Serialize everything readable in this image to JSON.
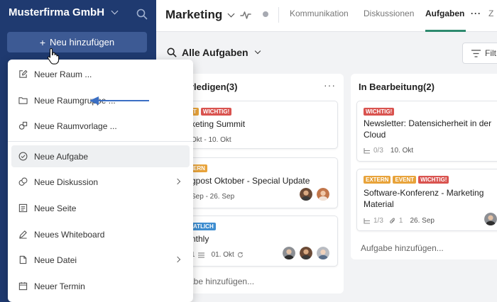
{
  "sidebar": {
    "org_name": "Musterfirma GmbH",
    "add_button_label": "Neu hinzufügen"
  },
  "header": {
    "title": "Marketing",
    "tabs": [
      {
        "label": "Kommunikation",
        "active": false
      },
      {
        "label": "Diskussionen",
        "active": false
      },
      {
        "label": "Aufgaben",
        "active": true
      },
      {
        "label": "Z",
        "active": false
      }
    ],
    "more_label": "···",
    "accent_color": "#2e8a6e"
  },
  "filter_bar": {
    "view_label": "Alle Aufgaben",
    "filter_label": "Filt"
  },
  "menu": {
    "items": [
      {
        "label": "Neuer Raum ...",
        "icon": "edit-icon"
      },
      {
        "label": "Neue Raumgruppe ...",
        "icon": "folder-icon"
      },
      {
        "label": "Neue Raumvorlage ...",
        "icon": "template-icon"
      },
      {
        "label": "Neue Aufgabe",
        "icon": "check-circle-icon",
        "highlighted": true
      },
      {
        "label": "Neue Diskussion",
        "icon": "discussion-icon",
        "submenu": true
      },
      {
        "label": "Neue Seite",
        "icon": "page-icon"
      },
      {
        "label": "Neues Whiteboard",
        "icon": "pen-icon"
      },
      {
        "label": "Neue Datei",
        "icon": "file-icon",
        "submenu": true
      },
      {
        "label": "Neuer Termin",
        "icon": "calendar-icon"
      }
    ]
  },
  "board": {
    "columns": [
      {
        "title": "rledigen(3)",
        "more": "···",
        "cards": [
          {
            "tags": [
              {
                "text": "T",
                "color": "orange"
              },
              {
                "text": "WICHTIG!",
                "color": "red"
              }
            ],
            "title": "keting Summit",
            "meta": "Okt - 10. Okt"
          },
          {
            "tags": [
              {
                "text": "ERN",
                "color": "orange"
              }
            ],
            "title": "gpost Oktober - Special Update",
            "meta": "Sep - 26. Sep"
          },
          {
            "tags": [
              {
                "text": "ATLICH",
                "color": "blue"
              }
            ],
            "title": "nthly",
            "meta_count": "1",
            "meta_date": "01. Okt"
          }
        ],
        "add_label": "abe hinzufügen..."
      },
      {
        "title": "In Bearbeitung(2)",
        "cards": [
          {
            "tags": [
              {
                "text": "WICHTIG!",
                "color": "red"
              }
            ],
            "title_line1": "Newsletter: Datensicherheit in der",
            "title_line2": "Cloud",
            "subtasks": "0/3",
            "date": "10. Okt"
          },
          {
            "tags": [
              {
                "text": "EXTERN",
                "color": "orange"
              },
              {
                "text": "EVENT",
                "color": "orange"
              },
              {
                "text": "WICHTIG!",
                "color": "red"
              }
            ],
            "title_line1": "Software-Konferenz - Marketing",
            "title_line2": "Material",
            "subtasks": "1/3",
            "attachments": "1",
            "date": "26. Sep"
          }
        ],
        "add_label": "Aufgabe hinzufügen..."
      }
    ]
  }
}
